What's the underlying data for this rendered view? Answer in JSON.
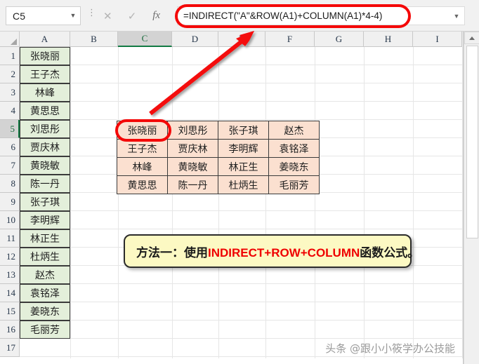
{
  "formula_bar": {
    "name_box_value": "C5",
    "name_box_arrow": "▼",
    "cancel_icon": "✕",
    "confirm_icon": "✓",
    "fx_label": "fx",
    "separator": "⋮",
    "formula_value": "=INDIRECT(\"A\"&ROW(A1)+COLUMN(A1)*4-4)",
    "expand_arrow": "▼"
  },
  "grid": {
    "column_headers": [
      "A",
      "B",
      "C",
      "D",
      "E",
      "F",
      "G",
      "H",
      "I"
    ],
    "selected_column": "C",
    "selected_row": "5",
    "row_headers": [
      "1",
      "2",
      "3",
      "4",
      "5",
      "6",
      "7",
      "8",
      "9",
      "10",
      "11",
      "12",
      "13",
      "14",
      "15",
      "16",
      "17"
    ],
    "column_a_values": [
      "张晓丽",
      "王子杰",
      "林峰",
      "黄思思",
      "刘思彤",
      "贾庆林",
      "黄晓敏",
      "陈一丹",
      "张子琪",
      "李明辉",
      "林正生",
      "杜炳生",
      "赵杰",
      "袁铭泽",
      "姜晓东",
      "毛丽芳"
    ]
  },
  "result_table": {
    "rows": [
      [
        "张晓丽",
        "刘思彤",
        "张子琪",
        "赵杰"
      ],
      [
        "王子杰",
        "贾庆林",
        "李明辉",
        "袁铭泽"
      ],
      [
        "林峰",
        "黄晓敏",
        "林正生",
        "姜晓东"
      ],
      [
        "黄思思",
        "陈一丹",
        "杜炳生",
        "毛丽芳"
      ]
    ]
  },
  "callout": {
    "prefix": "方法一：使用",
    "functions": "INDIRECT+ROW+COLUMN",
    "suffix": "函数公式。"
  },
  "watermark": {
    "text": "头条 @跟小小筱学办公技能"
  },
  "colors": {
    "source_fill": "#e3efda",
    "result_fill": "#fbe0d0",
    "highlight_red": "#f40808",
    "callout_fill": "#fcf9c3",
    "selected_header": "#d3d3d3",
    "header_accent_green": "#127a43"
  }
}
